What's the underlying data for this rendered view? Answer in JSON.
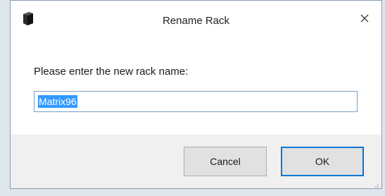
{
  "window": {
    "title": "Rename Rack",
    "app_icon": "rack-app-icon",
    "close_icon": "close-icon"
  },
  "content": {
    "prompt": "Please enter the new rack name:",
    "rack_name_value": "Matrix96",
    "value_selected": true
  },
  "buttons": {
    "cancel_label": "Cancel",
    "ok_label": "OK"
  },
  "colors": {
    "selection_highlight": "#3399ff",
    "focus_border": "#0078d7",
    "footer_background": "#f0f0f0"
  }
}
